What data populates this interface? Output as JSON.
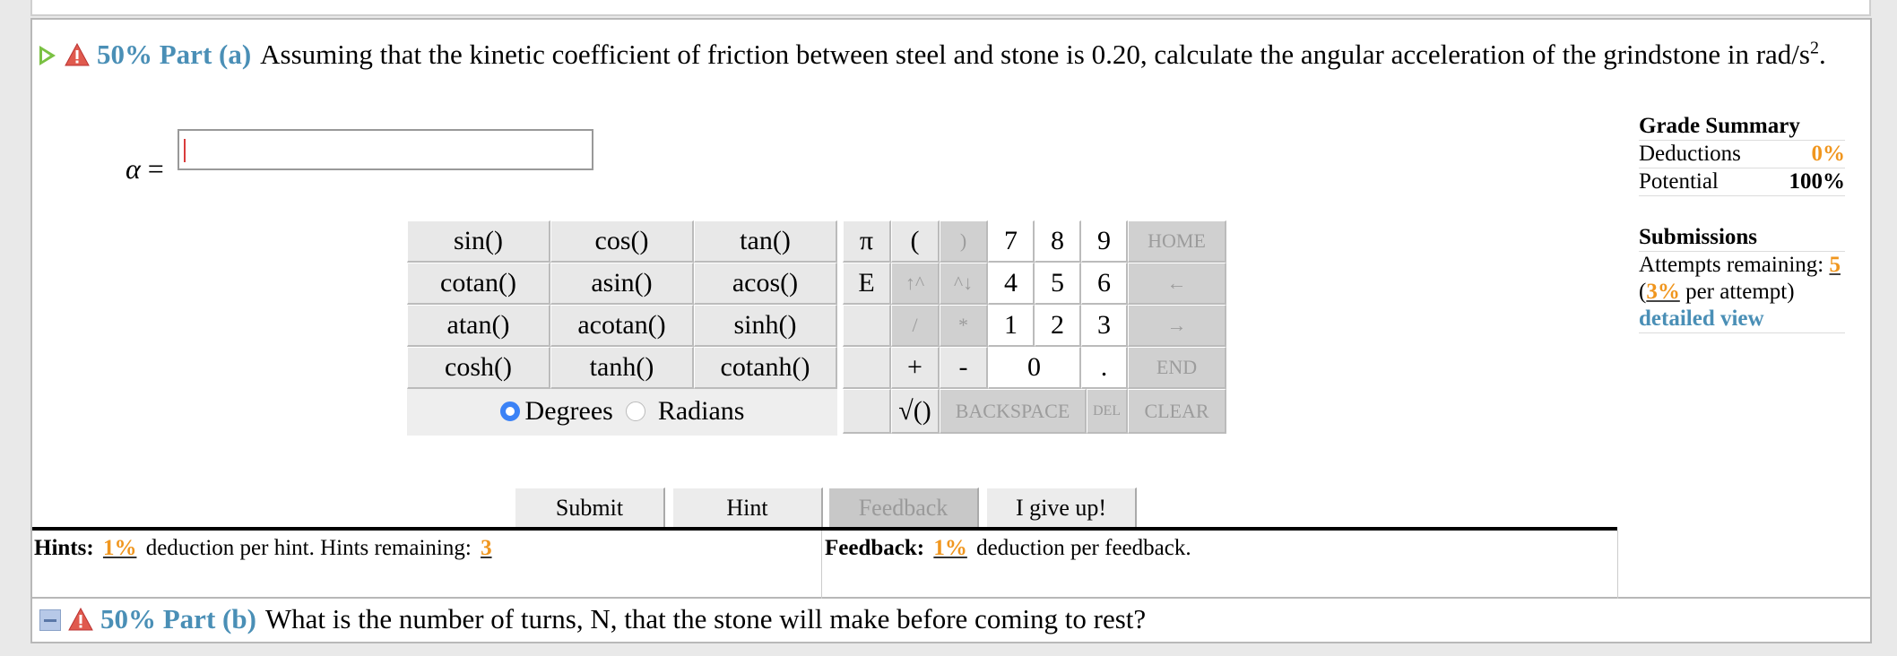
{
  "part_a": {
    "percent": "50% Part (a)",
    "question": "Assuming that the kinetic coefficient of friction between steel and stone is 0.20, calculate the angular acceleration of the grindstone in rad/s",
    "question_sup": "2",
    "question_end": "."
  },
  "answer": {
    "label": "α",
    "eq": " =",
    "value": ""
  },
  "grade_summary": {
    "title": "Grade Summary",
    "deductions_label": "Deductions",
    "deductions_value": "0%",
    "potential_label": "Potential",
    "potential_value": "100%"
  },
  "submissions": {
    "title": "Submissions",
    "attempts_label": "Attempts remaining: ",
    "attempts_value": "5",
    "per_attempt_open": "(",
    "per_attempt_value": "3%",
    "per_attempt_label": " per attempt)",
    "detail_link": "detailed view"
  },
  "keypad": {
    "functions": [
      [
        "sin()",
        "cos()",
        "tan()"
      ],
      [
        "cotan()",
        "asin()",
        "acos()"
      ],
      [
        "atan()",
        "acotan()",
        "sinh()"
      ],
      [
        "cosh()",
        "tanh()",
        "cotanh()"
      ]
    ],
    "degrees": "Degrees",
    "radians": "Radians",
    "pi": "π",
    "e": "E",
    "open_paren": "(",
    "close_paren": ")",
    "up_up": "↑^",
    "up_down": "^↓",
    "slash": "/",
    "star": "*",
    "plus": "+",
    "minus": "-",
    "sqrt": "√()",
    "digits": [
      "7",
      "8",
      "9",
      "4",
      "5",
      "6",
      "1",
      "2",
      "3",
      "0",
      "."
    ],
    "home": "HOME",
    "left": "←",
    "right": "→",
    "end": "END",
    "backspace": "BACKSPACE",
    "del": "DEL",
    "clear": "CLEAR"
  },
  "buttons": {
    "submit": "Submit",
    "hint": "Hint",
    "feedback": "Feedback",
    "give_up": "I give up!"
  },
  "hints": {
    "label": "Hints:",
    "deduction": "1%",
    "text": " deduction per hint. Hints remaining: ",
    "remaining": "3"
  },
  "feedback": {
    "label": "Feedback:",
    "deduction": "1%",
    "text": " deduction per feedback."
  },
  "part_b": {
    "percent": "50% Part (b)",
    "question": "What is the number of turns, N, that the stone will make before coming to rest?"
  }
}
